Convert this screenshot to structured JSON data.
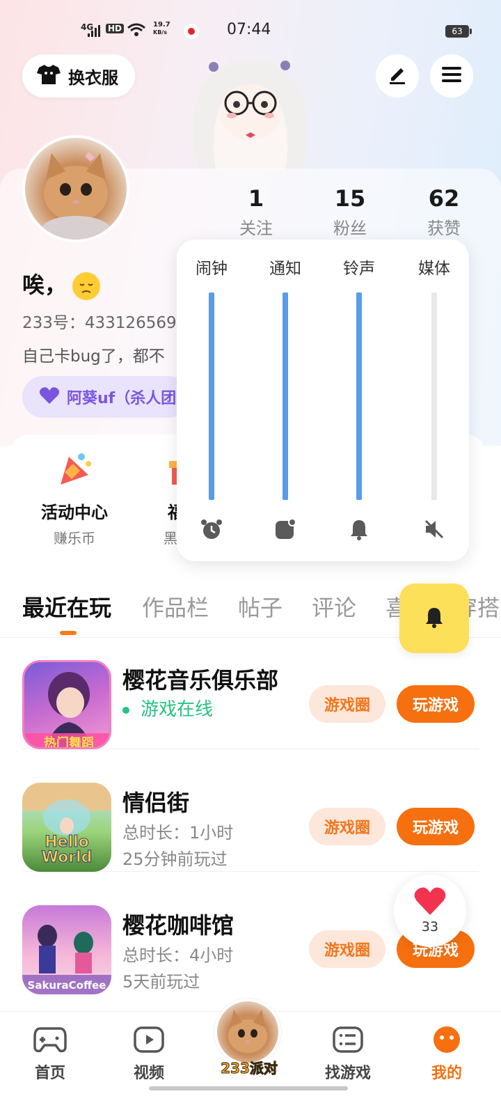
{
  "status_bar": {
    "network": "4G",
    "hd": "HD",
    "speed": "19.7",
    "speed_unit": "KB/s",
    "time": "07:44",
    "battery": "63"
  },
  "header": {
    "wardrobe_label": "换衣服"
  },
  "profile": {
    "stats": [
      {
        "value": "1",
        "label": "关注"
      },
      {
        "value": "15",
        "label": "粉丝"
      },
      {
        "value": "62",
        "label": "获赞"
      }
    ],
    "name": "唉，",
    "uid_text": "233号：433126569",
    "bio": "自己卡bug了，都不",
    "tag": "阿葵uf（杀人团"
  },
  "features": [
    {
      "name": "活动中心",
      "sub": "赚乐币"
    },
    {
      "name": "福利",
      "sub": "黑神话"
    }
  ],
  "volume_panel": {
    "channels": [
      {
        "label": "闹钟",
        "icon": "alarm-clock-icon",
        "level": 1.0
      },
      {
        "label": "通知",
        "icon": "notification-icon",
        "level": 1.0
      },
      {
        "label": "铃声",
        "icon": "bell-icon",
        "level": 1.0
      },
      {
        "label": "媒体",
        "icon": "muted-speaker-icon",
        "level": 0.0
      }
    ]
  },
  "tabs": [
    "最近在玩",
    "作品栏",
    "帖子",
    "评论",
    "喜",
    "穿搭"
  ],
  "games": [
    {
      "title": "樱花音乐俱乐部",
      "status": "游戏在线",
      "circle_label": "游戏圈",
      "play_label": "玩游戏",
      "icon_text": "热门舞蹈"
    },
    {
      "title": "情侣街",
      "duration": "总时长：1小时",
      "last_played": "25分钟前玩过",
      "circle_label": "游戏圈",
      "play_label": "玩游戏",
      "icon_text": "Hello World"
    },
    {
      "title": "樱花咖啡馆",
      "duration": "总时长：4小时",
      "last_played": "5天前玩过",
      "circle_label": "游戏圈",
      "play_label": "玩游戏",
      "icon_text": "SakuraCoffee"
    }
  ],
  "like_fab": {
    "count": "33"
  },
  "bottom_nav": [
    {
      "label": "首页",
      "icon": "gamepad-icon"
    },
    {
      "label": "视频",
      "icon": "play-icon"
    },
    {
      "label": "233派对",
      "icon": "party-avatar"
    },
    {
      "label": "找游戏",
      "icon": "list-icon"
    },
    {
      "label": "我的",
      "icon": "me-icon"
    }
  ],
  "colors": {
    "accent": "#f6700f",
    "volume_fill": "#5a9bea",
    "online": "#26c281",
    "bell_fab": "#fde05a"
  }
}
